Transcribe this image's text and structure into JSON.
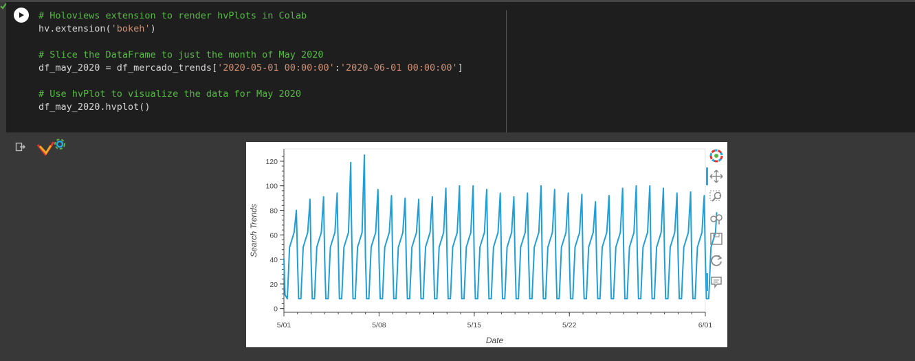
{
  "code_cell": {
    "lines": [
      {
        "parts": [
          {
            "t": "# Holoviews extension to render hvPlots in Colab",
            "c": "comment"
          }
        ]
      },
      {
        "parts": [
          {
            "t": "hv.extension(",
            "c": "plain"
          },
          {
            "t": "'bokeh'",
            "c": "str"
          },
          {
            "t": ")",
            "c": "plain"
          }
        ]
      },
      {
        "parts": []
      },
      {
        "parts": [
          {
            "t": "# Slice the DataFrame to just the month of May 2020",
            "c": "comment"
          }
        ]
      },
      {
        "parts": [
          {
            "t": "df_may_2020 = df_mercado_trends[",
            "c": "plain"
          },
          {
            "t": "'2020-05-01 00:00:00'",
            "c": "str"
          },
          {
            "t": ":",
            "c": "plain"
          },
          {
            "t": "'2020-06-01 00:00:00'",
            "c": "str"
          },
          {
            "t": "]",
            "c": "plain"
          }
        ]
      },
      {
        "parts": []
      },
      {
        "parts": [
          {
            "t": "# Use hvPlot to visualize the data for May 2020",
            "c": "comment"
          }
        ]
      },
      {
        "parts": [
          {
            "t": "df_may_2020.hvplot()",
            "c": "plain"
          }
        ]
      }
    ]
  },
  "colors": {
    "line": "#1f9fd6",
    "comment": "#57b846",
    "string": "#ce9178",
    "code_bg": "#1e1e1e",
    "page_bg": "#383838",
    "active_tool": "#26aae1"
  },
  "toolbar": {
    "tools": [
      {
        "icon": "bokeh-logo-icon",
        "active": false
      },
      {
        "icon": "pan-icon",
        "active": true
      },
      {
        "icon": "box-zoom-icon",
        "active": false
      },
      {
        "icon": "wheel-zoom-icon",
        "active": false
      },
      {
        "icon": "save-icon",
        "active": false
      },
      {
        "icon": "reset-icon",
        "active": false
      },
      {
        "icon": "hover-icon",
        "active": true
      }
    ]
  },
  "chart_data": {
    "type": "line",
    "xlabel": "Date",
    "ylabel": "Search Trends",
    "xlim": [
      "2020-05-01 00:00",
      "2020-06-01 00:00"
    ],
    "ylim": [
      -3,
      130
    ],
    "x_ticks": [
      "5/01",
      "5/08",
      "5/15",
      "5/22",
      "6/01"
    ],
    "y_ticks": [
      0,
      20,
      40,
      60,
      80,
      100,
      120
    ],
    "grid": false,
    "legend": "none",
    "series": [
      {
        "sampling": "hourly",
        "daily_peaks": [
          {
            "date": "2020-05-01",
            "peak": 80
          },
          {
            "date": "2020-05-02",
            "peak": 89
          },
          {
            "date": "2020-05-03",
            "peak": 91
          },
          {
            "date": "2020-05-04",
            "peak": 94
          },
          {
            "date": "2020-05-05",
            "peak": 119
          },
          {
            "date": "2020-05-06",
            "peak": 125
          },
          {
            "date": "2020-05-07",
            "peak": 97
          },
          {
            "date": "2020-05-08",
            "peak": 92
          },
          {
            "date": "2020-05-09",
            "peak": 90
          },
          {
            "date": "2020-05-10",
            "peak": 89
          },
          {
            "date": "2020-05-11",
            "peak": 91
          },
          {
            "date": "2020-05-12",
            "peak": 98
          },
          {
            "date": "2020-05-13",
            "peak": 100
          },
          {
            "date": "2020-05-14",
            "peak": 100
          },
          {
            "date": "2020-05-15",
            "peak": 97
          },
          {
            "date": "2020-05-16",
            "peak": 94
          },
          {
            "date": "2020-05-17",
            "peak": 91
          },
          {
            "date": "2020-05-18",
            "peak": 94
          },
          {
            "date": "2020-05-19",
            "peak": 100
          },
          {
            "date": "2020-05-20",
            "peak": 97
          },
          {
            "date": "2020-05-21",
            "peak": 94
          },
          {
            "date": "2020-05-22",
            "peak": 93
          },
          {
            "date": "2020-05-23",
            "peak": 87
          },
          {
            "date": "2020-05-24",
            "peak": 92
          },
          {
            "date": "2020-05-25",
            "peak": 98
          },
          {
            "date": "2020-05-26",
            "peak": 100
          },
          {
            "date": "2020-05-27",
            "peak": 100
          },
          {
            "date": "2020-05-28",
            "peak": 98
          },
          {
            "date": "2020-05-29",
            "peak": 94
          },
          {
            "date": "2020-05-30",
            "peak": 95
          },
          {
            "date": "2020-05-31",
            "peak": 92
          },
          {
            "date": "2020-06-01",
            "peak": 95
          }
        ],
        "daily_trough": 8
      }
    ]
  }
}
